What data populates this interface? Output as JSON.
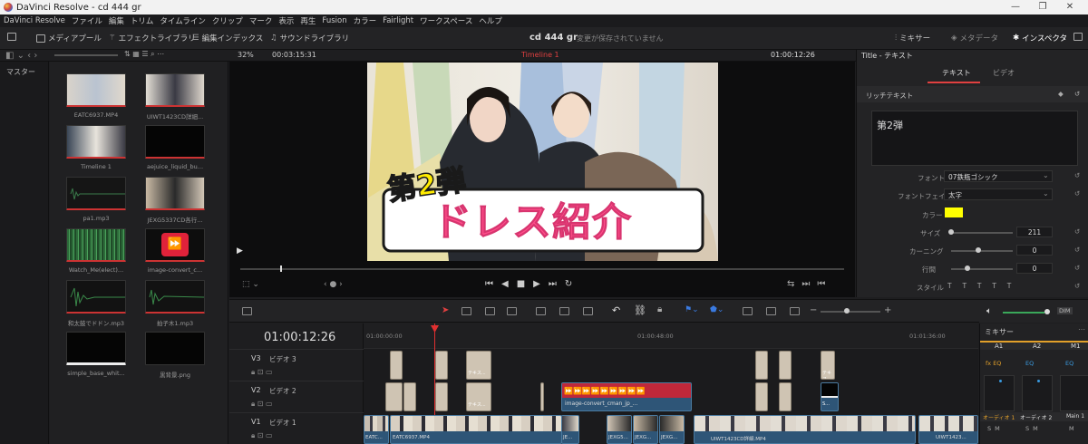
{
  "window": {
    "title": "DaVinci Resolve - cd 444 gr"
  },
  "menu": [
    "DaVinci Resolve",
    "ファイル",
    "編集",
    "トリム",
    "タイムライン",
    "クリップ",
    "マーク",
    "表示",
    "再生",
    "Fusion",
    "カラー",
    "Fairlight",
    "ワークスペース",
    "ヘルプ"
  ],
  "toolbar": {
    "media_pool": "メディアプール",
    "effects_library": "エフェクトライブラリ",
    "edit_index": "編集インデックス",
    "sound_library": "サウンドライブラリ",
    "project_name": "cd 444 gr",
    "unsaved": "変更が保存されていません",
    "mixer": "ミキサー",
    "metadata": "メタデータ",
    "inspector": "インスペクタ"
  },
  "subbar": {
    "zoom": "32%",
    "duration": "00:03:15:31",
    "timeline_name": "Timeline 1",
    "timecode": "01:00:12:26"
  },
  "sidebar": {
    "master": "マスター"
  },
  "media_pool": [
    {
      "name": "EATC6937.MP4"
    },
    {
      "name": "UIWT1423CD詳細..."
    },
    {
      "name": "Timeline 1"
    },
    {
      "name": "aejuice_liquid_bu..."
    },
    {
      "name": "pa1.mp3"
    },
    {
      "name": "JEXG5337CD各行..."
    },
    {
      "name": "Watch_Me(elect)..."
    },
    {
      "name": "image-convert_c..."
    },
    {
      "name": "和太鼓でドドン.mp3"
    },
    {
      "name": "拍子木1.mp3"
    },
    {
      "name": "simple_base_whit..."
    },
    {
      "name": "黒背景.png"
    }
  ],
  "viewer": {
    "title_line1": "第2弾",
    "title_line2": "ドレス紹介"
  },
  "inspector": {
    "panel_title": "Title - テキスト",
    "tab_text": "テキスト",
    "tab_video": "ビデオ",
    "section": "リッチテキスト",
    "text_value": "第2弾",
    "font_label": "フォント",
    "font_value": "07鉄瓶ゴシック",
    "face_label": "フォントフェイス",
    "face_value": "太字",
    "color_label": "カラー",
    "color_value": "#ffff00",
    "size_label": "サイズ",
    "size_value": "211",
    "kerning_label": "カーニング",
    "kerning_value": "0",
    "leading_label": "行間",
    "leading_value": "0",
    "style_label": "スタイル"
  },
  "timeline": {
    "timecode": "01:00:12:26",
    "ruler": [
      "01:00:00:00",
      "01:00:48:00",
      "01:01:36:00"
    ],
    "tracks": [
      {
        "id": "V3",
        "name": "ビデオ 3"
      },
      {
        "id": "V2",
        "name": "ビデオ 2"
      },
      {
        "id": "V1",
        "name": "ビデオ 1"
      }
    ],
    "clips": {
      "text_label": "テキス...",
      "image_convert": "image-convert_cman_jp_...",
      "s_label": "S...",
      "v1_a": "EATC...",
      "v1_b": "EATC6937.MP4",
      "v1_c": "JE...",
      "v1_d": "JEXG5...",
      "v1_e": "JEXG...",
      "v1_f": "JEXG...",
      "v1_g": "UIWT1423CD詳細.MP4",
      "v1_h": "UIWT1423..."
    }
  },
  "mixer": {
    "title": "ミキサー",
    "channels": [
      "A1",
      "A2",
      "M1"
    ],
    "labels": [
      "オーディオ 1",
      "オーディオ 2",
      "Main 1"
    ],
    "dim": "DIM"
  }
}
